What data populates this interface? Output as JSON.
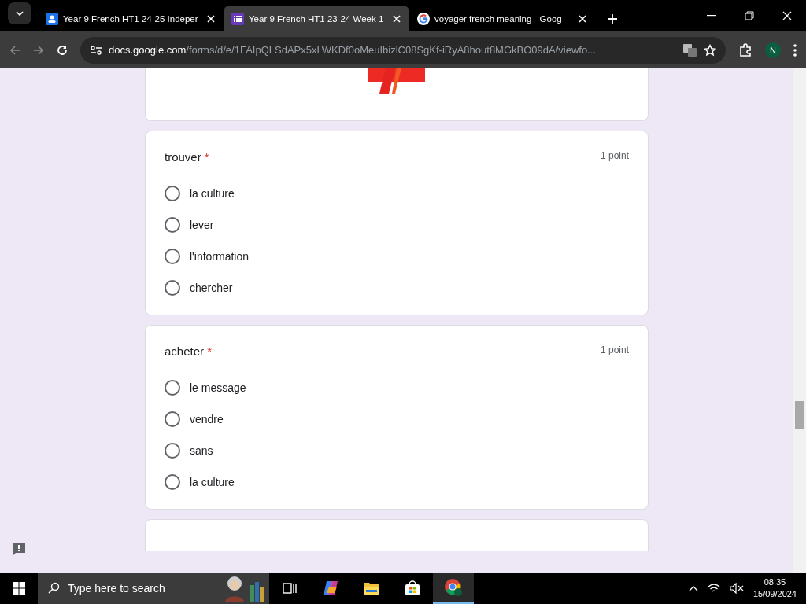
{
  "browser": {
    "tabs": [
      {
        "title": "Year 9 French HT1 24-25 Indeper",
        "kind": "classroom",
        "selected": false
      },
      {
        "title": "Year 9 French HT1 23-24 Week 1",
        "kind": "forms",
        "selected": true
      },
      {
        "title": "voyager french meaning - Goog",
        "kind": "google",
        "selected": false
      }
    ],
    "url_host": "docs.google.com",
    "url_path": "/forms/d/e/1FAIpQLSdAPx5xLWKDf0oMeuIbizlC08SgKf-iRyA8hout8MGkBO09dA/viewfo...",
    "profile": "N"
  },
  "questions": [
    {
      "title": "trouver",
      "required_mark": "*",
      "points": "1 point",
      "options": [
        {
          "label": "la culture",
          "selected": false
        },
        {
          "label": "lever",
          "selected": false
        },
        {
          "label": "l'information",
          "selected": false
        },
        {
          "label": "chercher",
          "selected": false
        }
      ]
    },
    {
      "title": "acheter",
      "required_mark": "*",
      "points": "1 point",
      "options": [
        {
          "label": "le message",
          "selected": false
        },
        {
          "label": "vendre",
          "selected": false
        },
        {
          "label": "sans",
          "selected": false
        },
        {
          "label": "la culture",
          "selected": false
        }
      ]
    }
  ],
  "taskbar": {
    "search_placeholder": "Type here to search",
    "time": "08:35",
    "date": "15/09/2024"
  }
}
